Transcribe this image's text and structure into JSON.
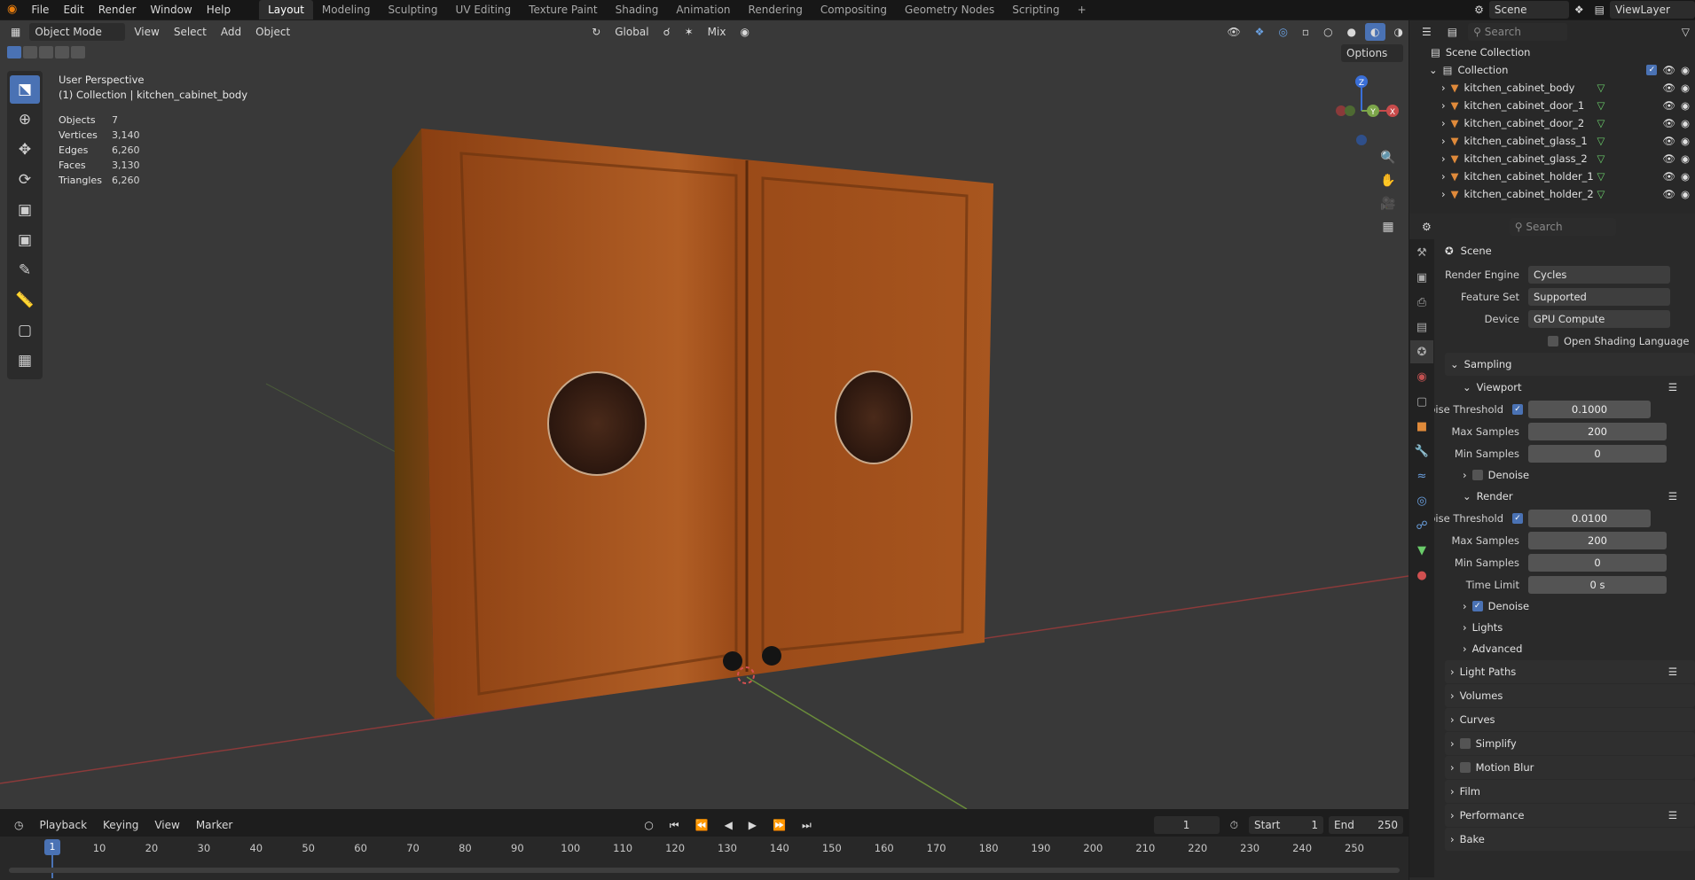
{
  "menu": [
    "File",
    "Edit",
    "Render",
    "Window",
    "Help"
  ],
  "workspaces": [
    "Layout",
    "Modeling",
    "Sculpting",
    "UV Editing",
    "Texture Paint",
    "Shading",
    "Animation",
    "Rendering",
    "Compositing",
    "Geometry Nodes",
    "Scripting"
  ],
  "active_workspace": "Layout",
  "scene_name": "Scene",
  "view_layer": "ViewLayer",
  "viewport_header": {
    "mode": "Object Mode",
    "menus": [
      "View",
      "Select",
      "Add",
      "Object"
    ],
    "orientation": "Global",
    "snap": "Mix",
    "options": "Options"
  },
  "viewport_info": {
    "perspective": "User Perspective",
    "collection_line": "(1) Collection | kitchen_cabinet_body"
  },
  "stats": [
    {
      "k": "Objects",
      "v": "7"
    },
    {
      "k": "Vertices",
      "v": "3,140"
    },
    {
      "k": "Edges",
      "v": "6,260"
    },
    {
      "k": "Faces",
      "v": "3,130"
    },
    {
      "k": "Triangles",
      "v": "6,260"
    }
  ],
  "gizmo": {
    "z": "Z",
    "y": "Y",
    "x": "X"
  },
  "outliner": {
    "search_placeholder": "Search",
    "root": "Scene Collection",
    "collection": "Collection",
    "objects": [
      "kitchen_cabinet_body",
      "kitchen_cabinet_door_1",
      "kitchen_cabinet_door_2",
      "kitchen_cabinet_glass_1",
      "kitchen_cabinet_glass_2",
      "kitchen_cabinet_holder_1",
      "kitchen_cabinet_holder_2"
    ]
  },
  "properties": {
    "search_placeholder": "Search",
    "context": "Scene",
    "render_engine_label": "Render Engine",
    "render_engine": "Cycles",
    "feature_set_label": "Feature Set",
    "feature_set": "Supported",
    "device_label": "Device",
    "device": "GPU Compute",
    "osl_label": "Open Shading Language",
    "sampling": "Sampling",
    "viewport": "Viewport",
    "render": "Render",
    "noise_threshold_label": "Noise Threshold",
    "max_samples_label": "Max Samples",
    "min_samples_label": "Min Samples",
    "time_limit_label": "Time Limit",
    "viewport_noise": "0.1000",
    "viewport_max": "200",
    "viewport_min": "0",
    "render_noise": "0.0100",
    "render_max": "200",
    "render_min": "0",
    "render_time_limit": "0 s",
    "denoise": "Denoise",
    "lights": "Lights",
    "advanced": "Advanced",
    "panels": [
      "Light Paths",
      "Volumes",
      "Curves",
      "Simplify",
      "Motion Blur",
      "Film",
      "Performance",
      "Bake"
    ]
  },
  "timeline": {
    "menus": [
      "Playback",
      "Keying",
      "View",
      "Marker"
    ],
    "current_frame": "1",
    "start_label": "Start",
    "start": "1",
    "end_label": "End",
    "end": "250",
    "ticks": [
      "1",
      "10",
      "20",
      "30",
      "40",
      "50",
      "60",
      "70",
      "80",
      "90",
      "100",
      "110",
      "120",
      "130",
      "140",
      "150",
      "160",
      "170",
      "180",
      "190",
      "200",
      "210",
      "220",
      "230",
      "240",
      "250"
    ]
  },
  "colors": {
    "accent": "#4a72b4",
    "wood": "#a0521f",
    "x_axis": "#c84b4b",
    "y_axis": "#7ca64a"
  }
}
